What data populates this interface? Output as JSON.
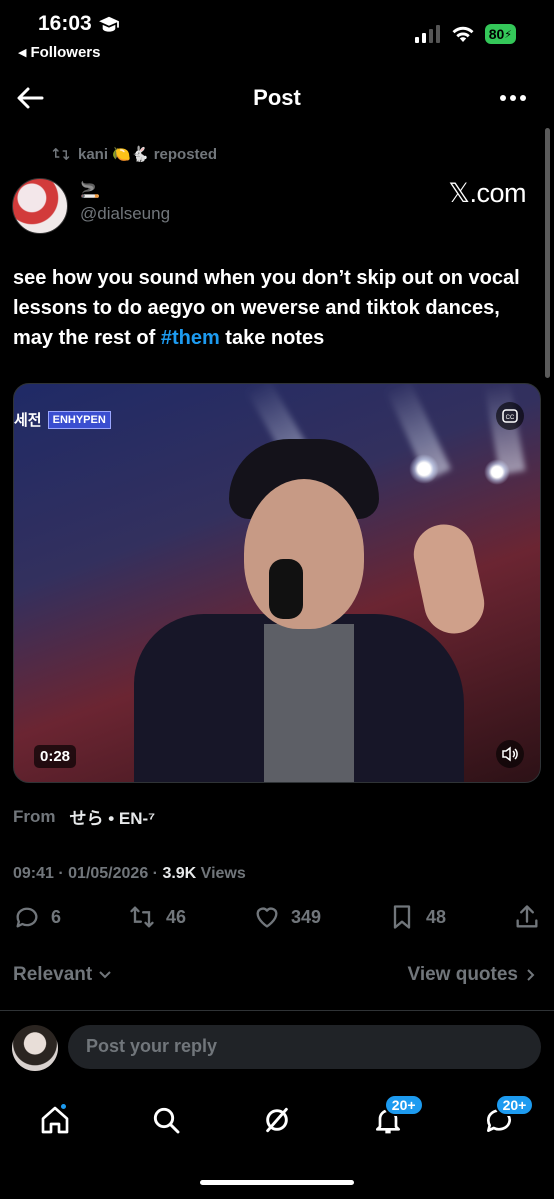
{
  "status_bar": {
    "time": "16:03",
    "back_app": "Followers",
    "battery": "80"
  },
  "header": {
    "title": "Post"
  },
  "repost": {
    "label": "kani 🍋🐇 reposted"
  },
  "author": {
    "name": "🚬",
    "handle": "@dialseung",
    "link_badge": "𝕏.com"
  },
  "post": {
    "text_before": "see how you sound when you don’t skip out on vocal lessons to do aegyo on weverse and tiktok dances, may the rest of ",
    "hashtag": "#them",
    "text_after": " take notes"
  },
  "media": {
    "duration": "0:28",
    "overlay_ko": "세전",
    "overlay_en": "ENHYPEN"
  },
  "from": {
    "label": "From",
    "source": "せら • EN-⁷"
  },
  "meta": {
    "timestamp": "09:41 · 01/05/2026 · ",
    "views_count": "3.9K",
    "views_label": " Views"
  },
  "actions": {
    "replies": "6",
    "reposts": "46",
    "likes": "349",
    "bookmarks": "48"
  },
  "sort": {
    "relevant": "Relevant",
    "view_quotes": "View quotes"
  },
  "reply": {
    "placeholder": "Post your reply"
  },
  "tabbar": {
    "notifications_badge": "20+",
    "messages_badge": "20+"
  },
  "colors": {
    "accent": "#1d9bf0",
    "muted": "#71767b",
    "background": "#000000"
  }
}
